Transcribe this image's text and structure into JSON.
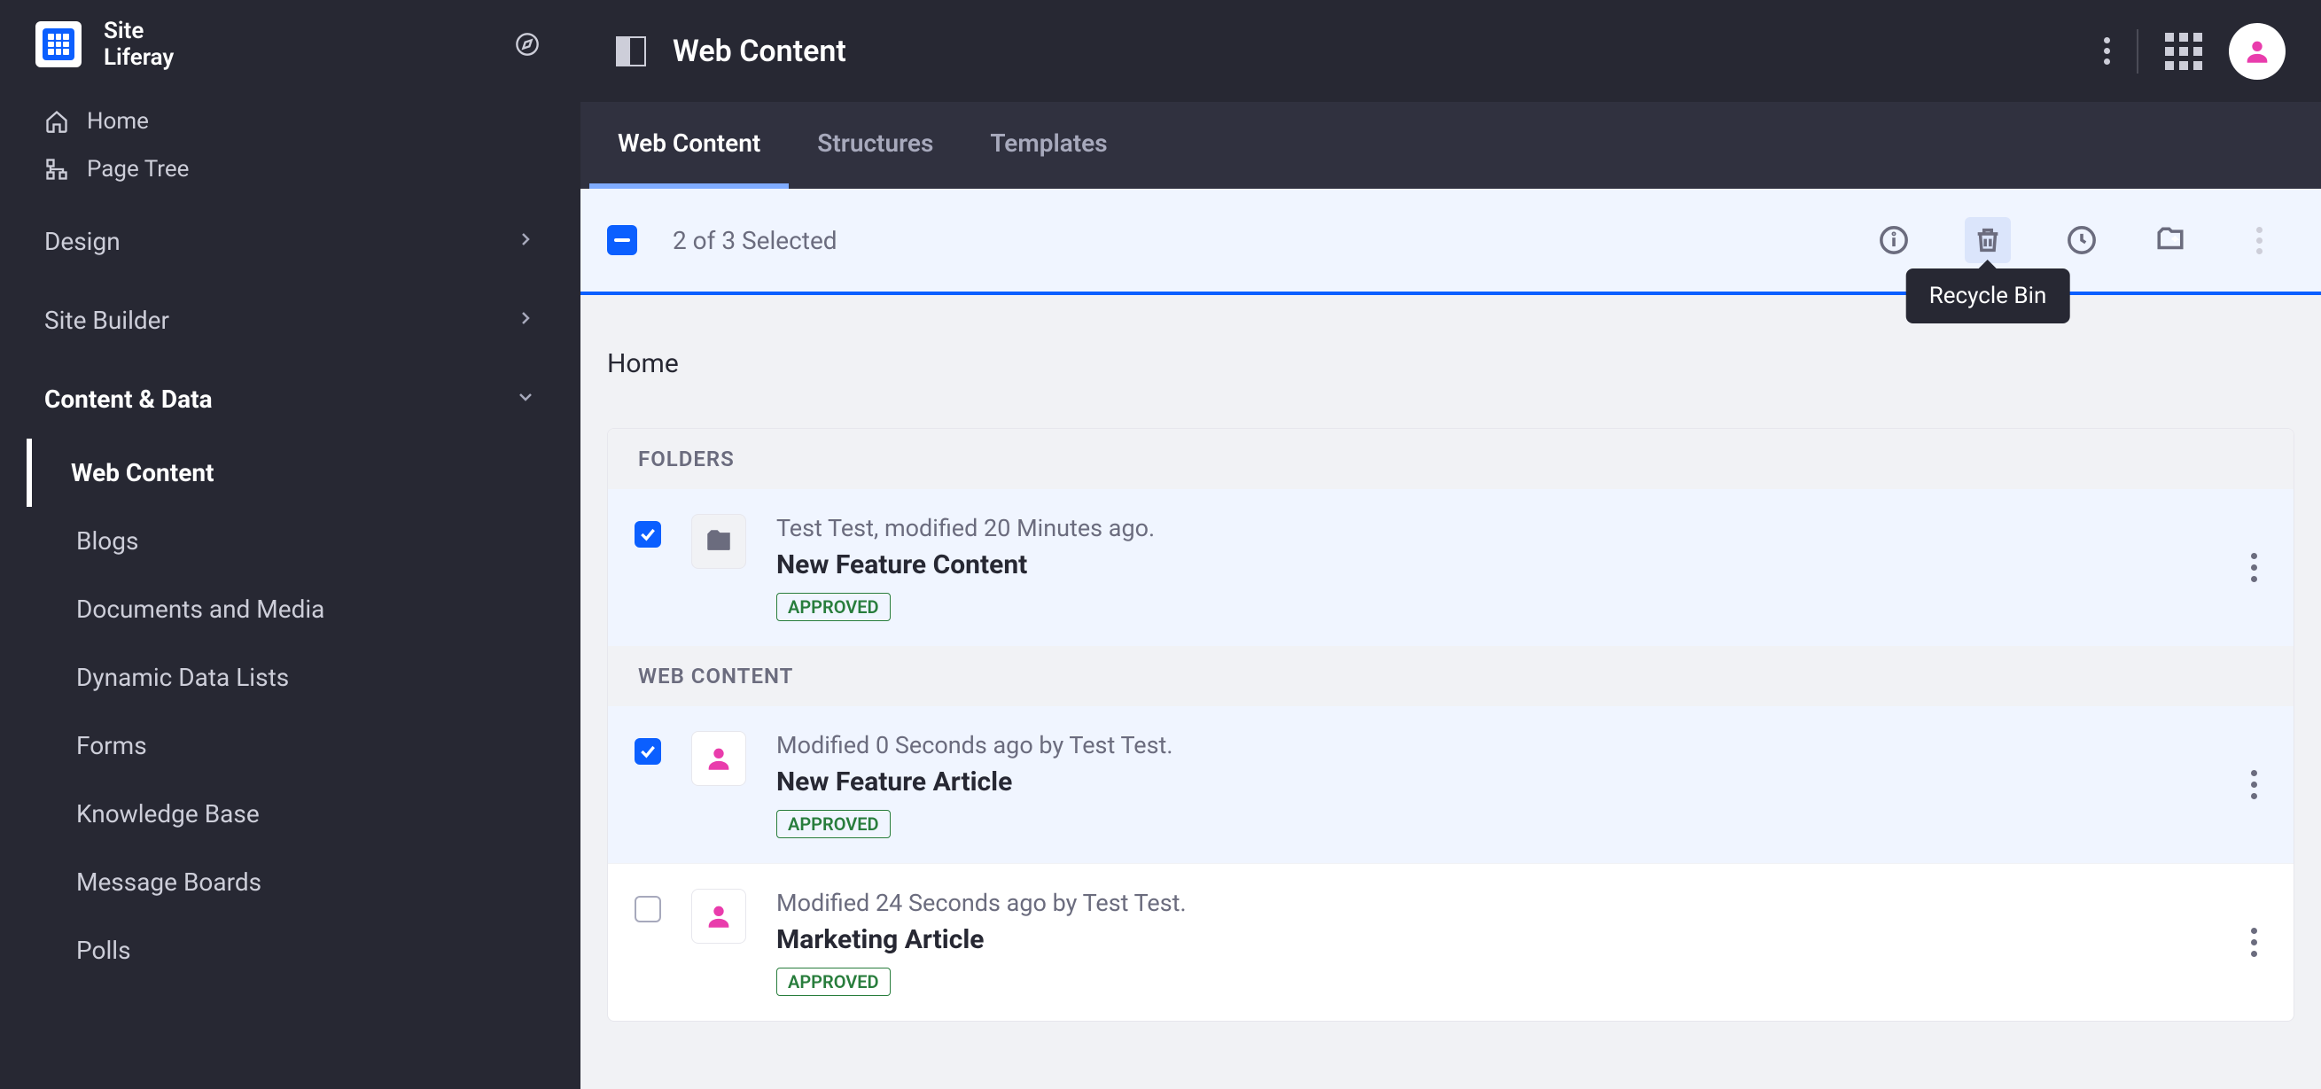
{
  "sidebar": {
    "site_label": "Site",
    "site_name": "Liferay",
    "quick": [
      {
        "label": "Home"
      },
      {
        "label": "Page Tree"
      }
    ],
    "groups": [
      {
        "label": "Design",
        "expanded": false
      },
      {
        "label": "Site Builder",
        "expanded": false
      },
      {
        "label": "Content & Data",
        "expanded": true
      }
    ],
    "content_data_items": [
      {
        "label": "Web Content",
        "active": true
      },
      {
        "label": "Blogs"
      },
      {
        "label": "Documents and Media"
      },
      {
        "label": "Dynamic Data Lists"
      },
      {
        "label": "Forms"
      },
      {
        "label": "Knowledge Base"
      },
      {
        "label": "Message Boards"
      },
      {
        "label": "Polls"
      }
    ]
  },
  "header": {
    "title": "Web Content"
  },
  "tabs": [
    {
      "label": "Web Content",
      "active": true
    },
    {
      "label": "Structures"
    },
    {
      "label": "Templates"
    }
  ],
  "mgmt": {
    "selection_text": "2 of 3 Selected",
    "tooltip": "Recycle Bin"
  },
  "breadcrumb": "Home",
  "sections": {
    "folders_header": "FOLDERS",
    "web_content_header": "WEB CONTENT"
  },
  "folders": [
    {
      "checked": true,
      "meta": "Test Test, modified 20 Minutes ago.",
      "title": "New Feature Content",
      "status": "APPROVED"
    }
  ],
  "articles": [
    {
      "checked": true,
      "meta": "Modified 0 Seconds ago by Test Test.",
      "title": "New Feature Article",
      "status": "APPROVED"
    },
    {
      "checked": false,
      "meta": "Modified 24 Seconds ago by Test Test.",
      "title": "Marketing Article",
      "status": "APPROVED"
    }
  ]
}
